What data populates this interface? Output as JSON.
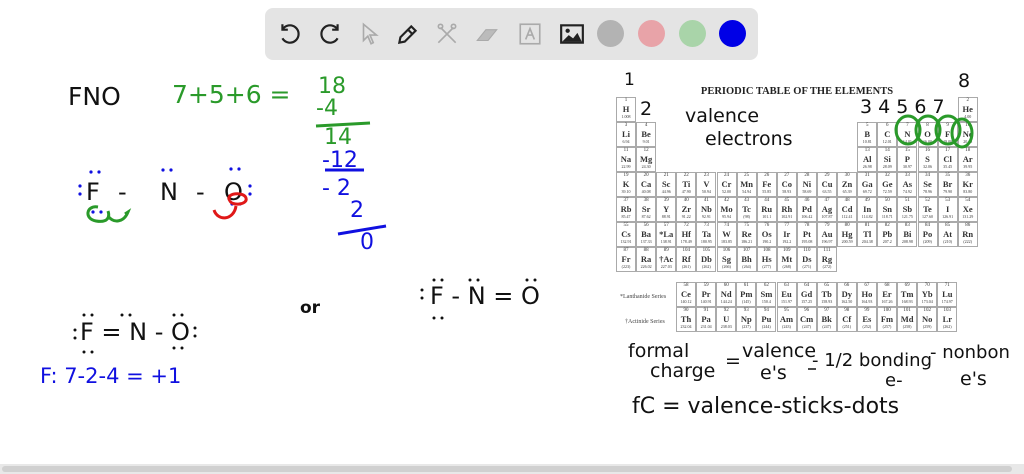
{
  "toolbar": {
    "tools": [
      "undo-icon",
      "redo-icon",
      "select-icon",
      "pencil-icon",
      "tools-icon",
      "eraser-icon",
      "text-icon",
      "image-icon"
    ],
    "colors": {
      "gray": "#b3b3b3",
      "pink": "#e8a3a8",
      "green": "#a9d4a9",
      "blue": "#0000e6"
    }
  },
  "board": {
    "formula": "FNO",
    "sum": "7+5+6 =",
    "total": "18",
    "minus4": "-4",
    "r14": "14",
    "minus12": "-12",
    "minus2": "- 2",
    "r2": "2",
    "r0": "0",
    "s1": {
      "f": "F",
      "d1": "-",
      "n": "N",
      "d2": "-",
      "o": "O"
    },
    "s2": {
      "text": "F = N - O"
    },
    "or": "or",
    "s3": {
      "text": "F - N = O"
    },
    "fc_f": "F: 7-2-4 = +1",
    "g1": "1",
    "g2": "2",
    "g345": "3 4 5 6 7",
    "g8": "8",
    "valence": "valence",
    "electrons": "electrons",
    "fc1a": "formal",
    "fc1b": "charge",
    "fc1eq": "=",
    "fc1c": "valence",
    "fc1d": "e's",
    "fc1e": "- 1/2 bonding",
    "fc1f": "e-",
    "fc1g": "- nonbon",
    "fc1h": "e's",
    "fc2": "fC = valence-sticks-dots"
  },
  "periodic_table": {
    "title": "PERIODIC TABLE OF THE ELEMENTS",
    "lanthanide_label": "*Lanthanide Series",
    "actinide_label": "†Actinide Series",
    "elements": [
      [
        1,
        "H",
        "1.008",
        1,
        1
      ],
      [
        2,
        "He",
        "4.00",
        1,
        18
      ],
      [
        3,
        "Li",
        "6.94",
        2,
        1
      ],
      [
        4,
        "Be",
        "9.01",
        2,
        2
      ],
      [
        5,
        "B",
        "10.81",
        2,
        13
      ],
      [
        6,
        "C",
        "12.01",
        2,
        14
      ],
      [
        7,
        "N",
        "14.01",
        2,
        15
      ],
      [
        8,
        "O",
        "16.00",
        2,
        16
      ],
      [
        9,
        "F",
        "19.00",
        2,
        17
      ],
      [
        10,
        "Ne",
        "20.18",
        2,
        18
      ],
      [
        11,
        "Na",
        "22.99",
        3,
        1
      ],
      [
        12,
        "Mg",
        "24.30",
        3,
        2
      ],
      [
        13,
        "Al",
        "26.98",
        3,
        13
      ],
      [
        14,
        "Si",
        "28.09",
        3,
        14
      ],
      [
        15,
        "P",
        "30.97",
        3,
        15
      ],
      [
        16,
        "S",
        "32.06",
        3,
        16
      ],
      [
        17,
        "Cl",
        "35.45",
        3,
        17
      ],
      [
        18,
        "Ar",
        "39.95",
        3,
        18
      ],
      [
        19,
        "K",
        "39.10",
        4,
        1
      ],
      [
        20,
        "Ca",
        "40.08",
        4,
        2
      ],
      [
        21,
        "Sc",
        "44.96",
        4,
        3
      ],
      [
        22,
        "Ti",
        "47.90",
        4,
        4
      ],
      [
        23,
        "V",
        "50.94",
        4,
        5
      ],
      [
        24,
        "Cr",
        "52.00",
        4,
        6
      ],
      [
        25,
        "Mn",
        "54.94",
        4,
        7
      ],
      [
        26,
        "Fe",
        "55.85",
        4,
        8
      ],
      [
        27,
        "Co",
        "58.93",
        4,
        9
      ],
      [
        28,
        "Ni",
        "58.69",
        4,
        10
      ],
      [
        29,
        "Cu",
        "63.55",
        4,
        11
      ],
      [
        30,
        "Zn",
        "65.39",
        4,
        12
      ],
      [
        31,
        "Ga",
        "69.72",
        4,
        13
      ],
      [
        32,
        "Ge",
        "72.59",
        4,
        14
      ],
      [
        33,
        "As",
        "74.92",
        4,
        15
      ],
      [
        34,
        "Se",
        "78.96",
        4,
        16
      ],
      [
        35,
        "Br",
        "79.90",
        4,
        17
      ],
      [
        36,
        "Kr",
        "83.80",
        4,
        18
      ],
      [
        37,
        "Rb",
        "85.47",
        5,
        1
      ],
      [
        38,
        "Sr",
        "87.62",
        5,
        2
      ],
      [
        39,
        "Y",
        "88.91",
        5,
        3
      ],
      [
        40,
        "Zr",
        "91.22",
        5,
        4
      ],
      [
        41,
        "Nb",
        "92.91",
        5,
        5
      ],
      [
        42,
        "Mo",
        "95.94",
        5,
        6
      ],
      [
        43,
        "Tc",
        "(98)",
        5,
        7
      ],
      [
        44,
        "Ru",
        "101.1",
        5,
        8
      ],
      [
        45,
        "Rh",
        "102.91",
        5,
        9
      ],
      [
        46,
        "Pd",
        "106.42",
        5,
        10
      ],
      [
        47,
        "Ag",
        "107.87",
        5,
        11
      ],
      [
        48,
        "Cd",
        "112.41",
        5,
        12
      ],
      [
        49,
        "In",
        "114.82",
        5,
        13
      ],
      [
        50,
        "Sn",
        "118.71",
        5,
        14
      ],
      [
        51,
        "Sb",
        "121.75",
        5,
        15
      ],
      [
        52,
        "Te",
        "127.60",
        5,
        16
      ],
      [
        53,
        "I",
        "126.91",
        5,
        17
      ],
      [
        54,
        "Xe",
        "131.29",
        5,
        18
      ],
      [
        55,
        "Cs",
        "132.91",
        6,
        1
      ],
      [
        56,
        "Ba",
        "137.33",
        6,
        2
      ],
      [
        57,
        "*La",
        "138.91",
        6,
        3
      ],
      [
        72,
        "Hf",
        "178.49",
        6,
        4
      ],
      [
        73,
        "Ta",
        "180.95",
        6,
        5
      ],
      [
        74,
        "W",
        "183.85",
        6,
        6
      ],
      [
        75,
        "Re",
        "186.21",
        6,
        7
      ],
      [
        76,
        "Os",
        "190.2",
        6,
        8
      ],
      [
        77,
        "Ir",
        "192.2",
        6,
        9
      ],
      [
        78,
        "Pt",
        "195.08",
        6,
        10
      ],
      [
        79,
        "Au",
        "196.97",
        6,
        11
      ],
      [
        80,
        "Hg",
        "200.59",
        6,
        12
      ],
      [
        81,
        "Tl",
        "204.38",
        6,
        13
      ],
      [
        82,
        "Pb",
        "207.2",
        6,
        14
      ],
      [
        83,
        "Bi",
        "208.98",
        6,
        15
      ],
      [
        84,
        "Po",
        "(209)",
        6,
        16
      ],
      [
        85,
        "At",
        "(210)",
        6,
        17
      ],
      [
        86,
        "Rn",
        "(222)",
        6,
        18
      ],
      [
        87,
        "Fr",
        "(223)",
        7,
        1
      ],
      [
        88,
        "Ra",
        "226.02",
        7,
        2
      ],
      [
        89,
        "†Ac",
        "227.03",
        7,
        3
      ],
      [
        104,
        "Rf",
        "(261)",
        7,
        4
      ],
      [
        105,
        "Db",
        "(262)",
        7,
        5
      ],
      [
        106,
        "Sg",
        "(266)",
        7,
        6
      ],
      [
        107,
        "Bh",
        "(264)",
        7,
        7
      ],
      [
        108,
        "Hs",
        "(277)",
        7,
        8
      ],
      [
        109,
        "Mt",
        "(268)",
        7,
        9
      ],
      [
        110,
        "Ds",
        "(271)",
        7,
        10
      ],
      [
        111,
        "Rg",
        "(272)",
        7,
        11
      ]
    ],
    "lanthanides": [
      [
        58,
        "Ce",
        "140.12"
      ],
      [
        59,
        "Pr",
        "140.91"
      ],
      [
        60,
        "Nd",
        "144.24"
      ],
      [
        61,
        "Pm",
        "(145)"
      ],
      [
        62,
        "Sm",
        "150.4"
      ],
      [
        63,
        "Eu",
        "151.97"
      ],
      [
        64,
        "Gd",
        "157.25"
      ],
      [
        65,
        "Tb",
        "158.93"
      ],
      [
        66,
        "Dy",
        "162.50"
      ],
      [
        67,
        "Ho",
        "164.93"
      ],
      [
        68,
        "Er",
        "167.26"
      ],
      [
        69,
        "Tm",
        "168.93"
      ],
      [
        70,
        "Yb",
        "173.04"
      ],
      [
        71,
        "Lu",
        "174.97"
      ]
    ],
    "actinides": [
      [
        90,
        "Th",
        "232.04"
      ],
      [
        91,
        "Pa",
        "231.04"
      ],
      [
        92,
        "U",
        "238.03"
      ],
      [
        93,
        "Np",
        "(237)"
      ],
      [
        94,
        "Pu",
        "(244)"
      ],
      [
        95,
        "Am",
        "(243)"
      ],
      [
        96,
        "Cm",
        "(247)"
      ],
      [
        97,
        "Bk",
        "(247)"
      ],
      [
        98,
        "Cf",
        "(251)"
      ],
      [
        99,
        "Es",
        "(252)"
      ],
      [
        100,
        "Fm",
        "(257)"
      ],
      [
        101,
        "Md",
        "(258)"
      ],
      [
        102,
        "No",
        "(259)"
      ],
      [
        103,
        "Lr",
        "(262)"
      ]
    ]
  }
}
